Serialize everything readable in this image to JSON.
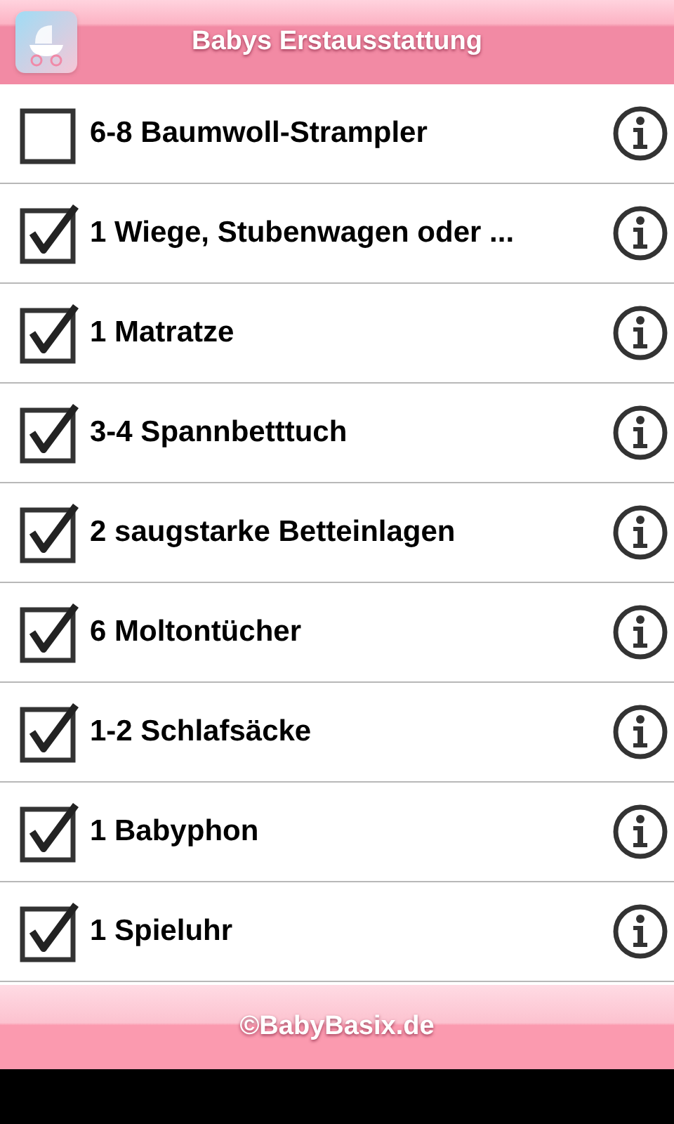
{
  "header": {
    "title": "Babys Erstausstattung"
  },
  "items": [
    {
      "label": "6-8 Baumwoll-Strampler",
      "checked": false
    },
    {
      "label": "1 Wiege, Stubenwagen oder ...",
      "checked": true
    },
    {
      "label": "1 Matratze",
      "checked": true
    },
    {
      "label": "3-4 Spannbetttuch",
      "checked": true
    },
    {
      "label": "2 saugstarke Betteinlagen",
      "checked": true
    },
    {
      "label": "6 Moltontücher",
      "checked": true
    },
    {
      "label": "1-2 Schlafsäcke",
      "checked": true
    },
    {
      "label": "1 Babyphon",
      "checked": true
    },
    {
      "label": "1 Spieluhr",
      "checked": true
    }
  ],
  "footer": {
    "text": "©BabyBasix.de"
  }
}
